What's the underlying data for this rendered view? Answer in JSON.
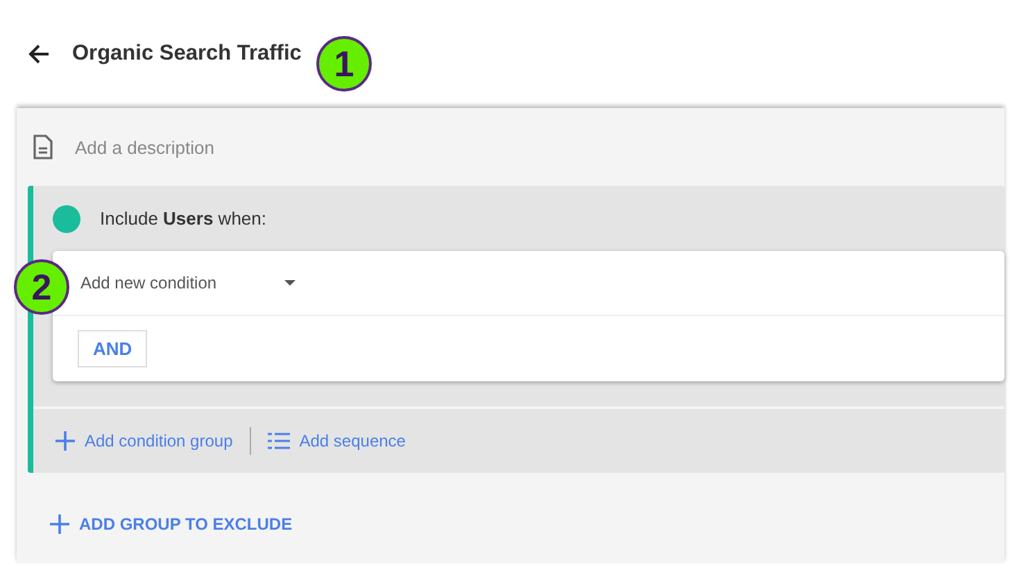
{
  "header": {
    "title": "Organic Search Traffic"
  },
  "description": {
    "placeholder": "Add a description"
  },
  "include_group": {
    "label": "Include **Users** when:",
    "color": "#1abc9c",
    "condition": {
      "placeholder": "Add new condition"
    },
    "operator": "AND",
    "actions": [
      {
        "kind": "group",
        "label": "Add condition group"
      },
      {
        "kind": "sequence",
        "label": "Add sequence"
      }
    ]
  },
  "exclude_button": "ADD GROUP TO EXCLUDE",
  "callouts": [
    {
      "label": "1"
    },
    {
      "label": "2"
    }
  ]
}
